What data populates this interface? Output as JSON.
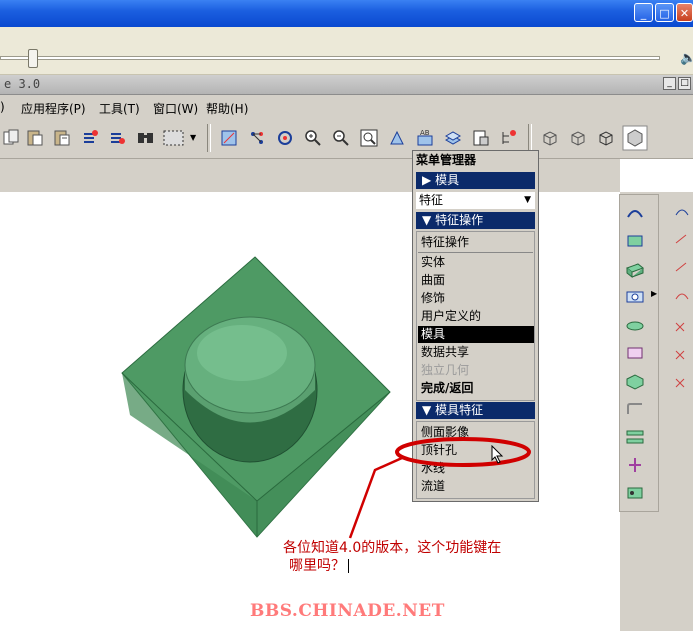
{
  "window": {
    "minimize_icon": "minimize-icon",
    "maximize_icon": "maximize-icon",
    "close_icon": "close-icon"
  },
  "app": {
    "title_fragment": "e 3.0"
  },
  "menubar": {
    "items": [
      "应用程序(P)",
      "工具(T)",
      "窗口(W)",
      "帮助(H)"
    ],
    "leading_fragment": ")"
  },
  "menu_manager": {
    "title": "菜单管理器",
    "section_mold": "模具",
    "feature_dropdown": "特征",
    "section_feature_ops": "特征操作",
    "feature_ops_items": [
      "特征操作"
    ],
    "items": [
      "实体",
      "曲面",
      "修饰",
      "用户定义的"
    ],
    "selected": "模具",
    "items_after": [
      "数据共享"
    ],
    "disabled_item": "独立几何",
    "done_return": "完成/返回",
    "section_mold_features": "模具特征",
    "mold_feature_items": [
      "侧面影像",
      "顶针孔",
      "水线",
      "流道"
    ]
  },
  "annotation": {
    "line1": "各位知道4.0的版本，这个功能键在",
    "line2": "哪里吗？"
  },
  "watermark": "BBS.CHINADE.NET",
  "colors": {
    "menu_header_bg": "#0b2a6a",
    "annotation_red": "#c00000",
    "model_green": "#4e9a64",
    "watermark": "#ff7a7a"
  }
}
